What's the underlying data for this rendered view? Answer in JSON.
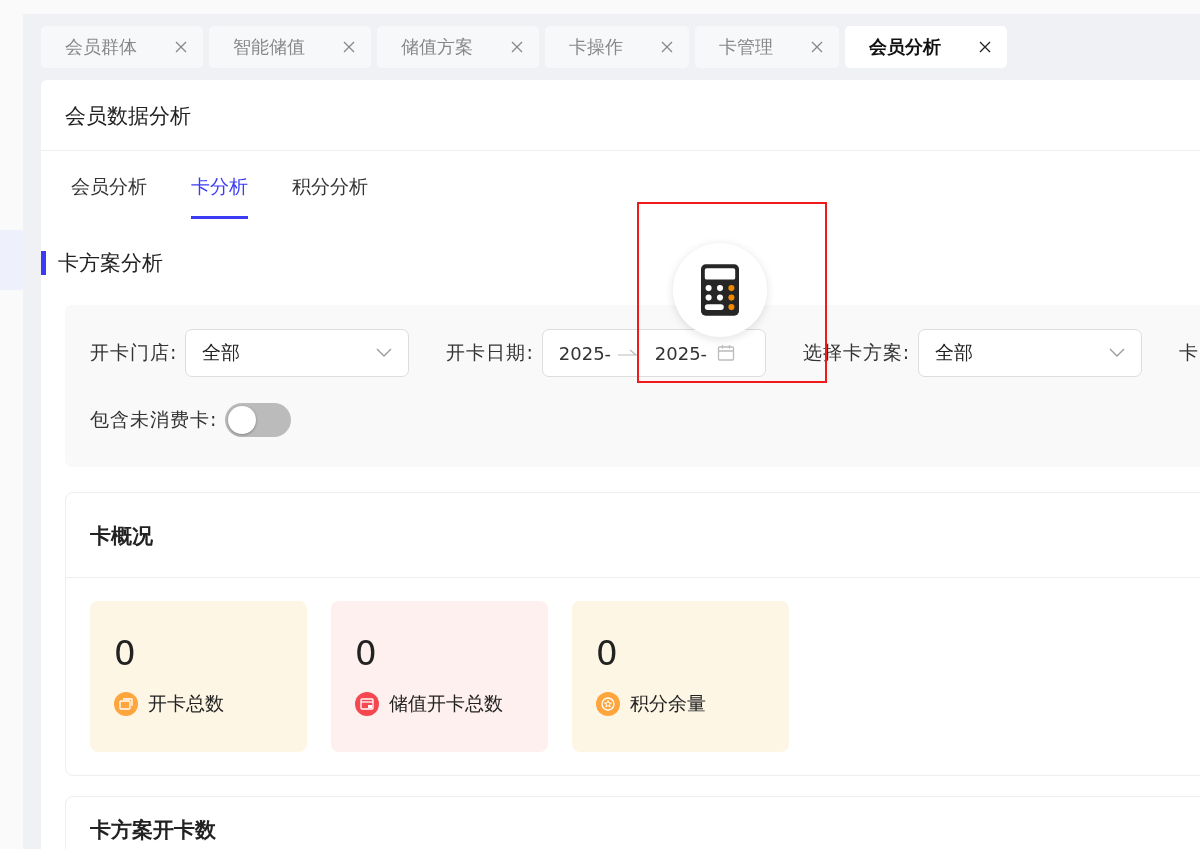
{
  "page_tabs": [
    {
      "label": "会员群体",
      "selected": false
    },
    {
      "label": "智能储值",
      "selected": false
    },
    {
      "label": "储值方案",
      "selected": false
    },
    {
      "label": "卡操作",
      "selected": false
    },
    {
      "label": "卡管理",
      "selected": false
    },
    {
      "label": "会员分析",
      "selected": true
    }
  ],
  "panel": {
    "title": "会员数据分析",
    "sub_tabs": [
      {
        "label": "会员分析",
        "selected": false
      },
      {
        "label": "卡分析",
        "selected": true
      },
      {
        "label": "积分分析",
        "selected": false
      }
    ],
    "section_title": "卡方案分析",
    "filters": [
      {
        "kind": "select",
        "label": "开卡门店:",
        "value": "全部"
      },
      {
        "kind": "daterange",
        "label": "开卡日期:",
        "start": "2025-",
        "end": "2025-"
      },
      {
        "kind": "select",
        "label": "选择卡方案:",
        "value": "全部"
      },
      {
        "kind": "cut",
        "label": "卡"
      },
      {
        "kind": "switch",
        "label": "包含未消费卡:",
        "on": false
      }
    ],
    "overview": {
      "title": "卡概况",
      "stats": [
        {
          "value": "0",
          "label": "开卡总数",
          "kind": "cards",
          "color": "#ffa53d"
        },
        {
          "value": "0",
          "label": "储值开卡总数",
          "kind": "wallet",
          "color": "#f5474f"
        },
        {
          "value": "0",
          "label": "积分余量",
          "kind": "points",
          "color": "#ffa53d"
        }
      ]
    },
    "next_card": {
      "title": "卡方案开卡数"
    }
  }
}
